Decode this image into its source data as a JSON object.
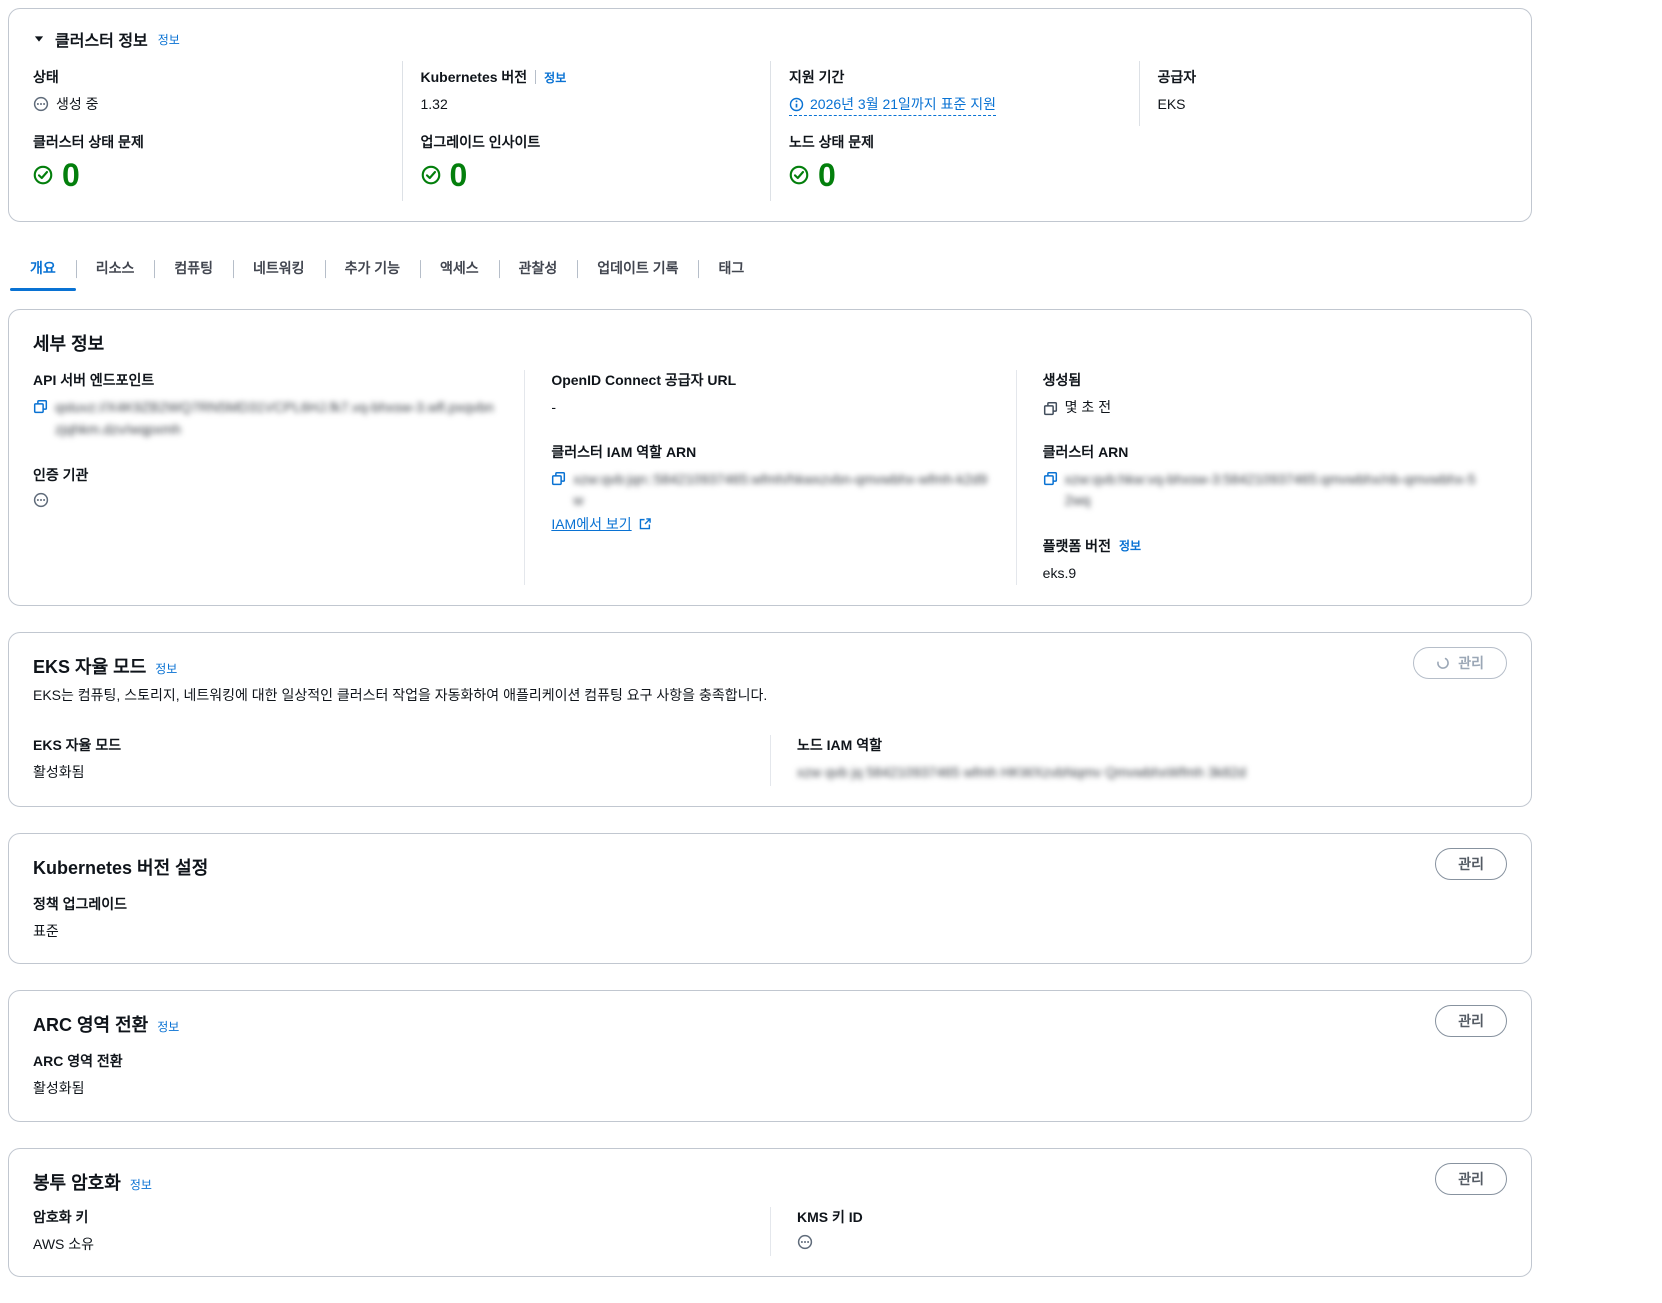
{
  "cluster_info": {
    "title": "클러스터 정보",
    "info": "정보",
    "row1": [
      {
        "label": "상태",
        "value": "생성 중"
      },
      {
        "label": "Kubernetes 버전",
        "info": "정보",
        "value": "1.32"
      },
      {
        "label": "지원 기간",
        "link": "2026년 3월 21일까지 표준 지원"
      },
      {
        "label": "공급자",
        "value": "EKS"
      }
    ],
    "row2": [
      {
        "label": "클러스터 상태 문제",
        "count": "0"
      },
      {
        "label": "업그레이드 인사이트",
        "count": "0"
      },
      {
        "label": "노드 상태 문제",
        "count": "0"
      }
    ]
  },
  "tabs": [
    {
      "label": "개요"
    },
    {
      "label": "리소스"
    },
    {
      "label": "컴퓨팅"
    },
    {
      "label": "네트워킹"
    },
    {
      "label": "추가 기능"
    },
    {
      "label": "액세스"
    },
    {
      "label": "관찰성"
    },
    {
      "label": "업데이트 기록"
    },
    {
      "label": "태그"
    }
  ],
  "details": {
    "title": "세부 정보",
    "api_endpoint_label": "API 서버 엔드포인트",
    "api_endpoint_redacted": "qstuvz://X4K9ZB2WQ7RN5MD31VCPL6HJ.fk7.vq-bhxsw-3.wfl.pxqvbnzjqhkm.dzv/wqpxmh",
    "cert_authority_label": "인증 기관",
    "oidc_label": "OpenID Connect 공급자 URL",
    "oidc_value": "-",
    "cluster_iam_label": "클러스터 IAM 역할 ARN",
    "cluster_iam_redacted": "xzw:qvb:jqn::584210937465:wfmh/hkwxzvbn-qmvwbhx-wfmh-k2d9w",
    "view_in_iam": "IAM에서 보기",
    "created_label": "생성됨",
    "created_value": "몇 초 전",
    "cluster_arn_label": "클러스터 ARN",
    "cluster_arn_redacted": "xzw:qvb:hkw:vq-bhxsw-3:584210937465:qmvwbhx/nb-qmvwbhx-52wq",
    "platform_label": "플랫폼 버전",
    "platform_info": "정보",
    "platform_value": "eks.9"
  },
  "auto_mode": {
    "title": "EKS 자율 모드",
    "info": "정보",
    "description": "EKS는 컴퓨팅, 스토리지, 네트워킹에 대한 일상적인 클러스터 작업을 자동화하여 애플리케이션 컴퓨팅 요구 사항을 충족합니다.",
    "mode_label": "EKS 자율 모드",
    "mode_value": "활성화됨",
    "node_iam_label": "노드 IAM 역할",
    "node_iam_redacted": "xzw qvb jq 584210937465 wfmh HKWXzvbNqmv QmvwbhxWfmh 3k82d",
    "manage_button": "관리"
  },
  "version_settings": {
    "title": "Kubernetes 버전 설정",
    "policy_label": "정책 업그레이드",
    "policy_value": "표준",
    "manage_button": "관리"
  },
  "arc": {
    "title": "ARC 영역 전환",
    "info": "정보",
    "label": "ARC 영역 전환",
    "value": "활성화됨",
    "manage_button": "관리"
  },
  "encryption": {
    "title": "봉투 암호화",
    "info": "정보",
    "key_label": "암호화 키",
    "key_value": "AWS 소유",
    "kms_label": "KMS 키 ID",
    "manage_button": "관리"
  }
}
